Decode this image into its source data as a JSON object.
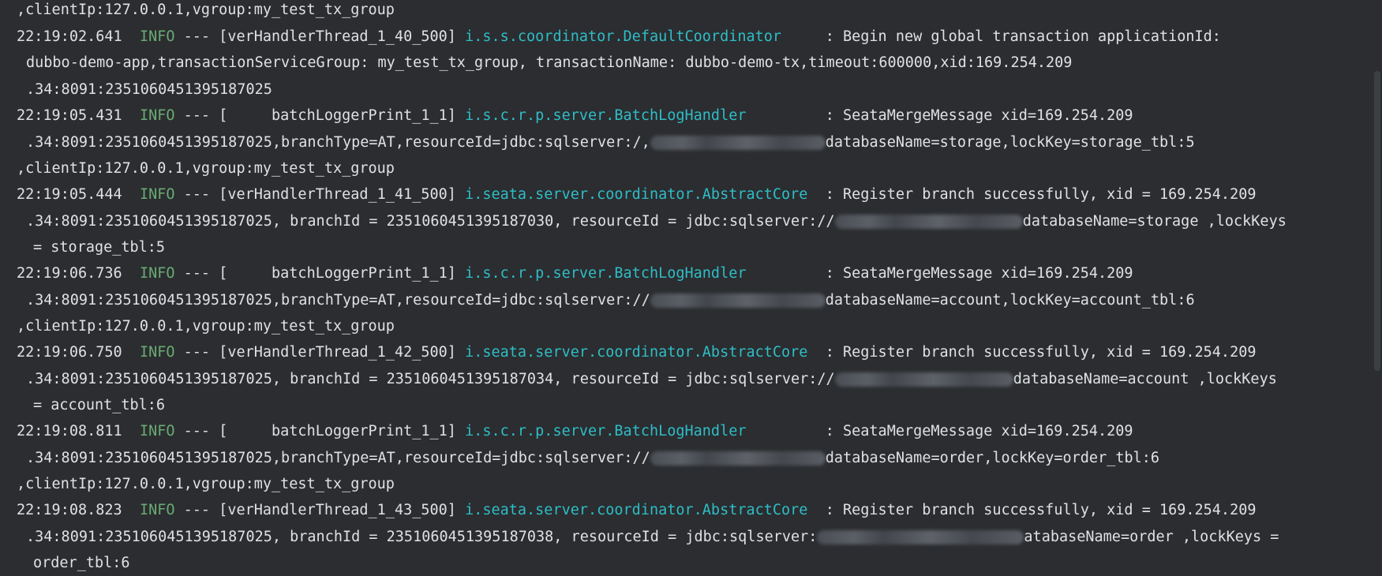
{
  "lines": [
    {
      "text": ",clientIp:127.0.0.1,vgroup:my_test_tx_group"
    },
    {
      "time": "22:19:02.641",
      "level": "INFO",
      "mid": " --- [verHandlerThread_1_40_500] ",
      "cls": "i.s.s.coordinator.DefaultCoordinator",
      "msg": "     : Begin new global transaction applicationId:"
    },
    {
      "text": "dubbo-demo-app,transactionServiceGroup: my_test_tx_group, transactionName: dubbo-demo-tx,timeout:600000,xid:169.254.209"
    },
    {
      "text": ".34:8091:2351060451395187025"
    },
    {
      "time": "22:19:05.431",
      "level": "INFO",
      "mid": " --- [     batchLoggerPrint_1_1] ",
      "cls": "i.s.c.r.p.server.BatchLogHandler",
      "msg": "         : SeataMergeMessage xid=169.254.209"
    },
    {
      "pre": ".34:8091:2351060451395187025,branchType=AT,resourceId=jdbc:sqlserver:/,",
      "post": "databaseName=storage,lockKey=storage_tbl:5"
    },
    {
      "text": ",clientIp:127.0.0.1,vgroup:my_test_tx_group"
    },
    {
      "time": "22:19:05.444",
      "level": "INFO",
      "mid": " --- [verHandlerThread_1_41_500] ",
      "cls": "i.seata.server.coordinator.AbstractCore",
      "msg": "  : Register branch successfully, xid = 169.254.209"
    },
    {
      "pre": ".34:8091:2351060451395187025, branchId = 2351060451395187030, resourceId = jdbc:sqlserver://",
      "post": "databaseName=storage ,lockKeys"
    },
    {
      "text": "= storage_tbl:5"
    },
    {
      "time": "22:19:06.736",
      "level": "INFO",
      "mid": " --- [     batchLoggerPrint_1_1] ",
      "cls": "i.s.c.r.p.server.BatchLogHandler",
      "msg": "         : SeataMergeMessage xid=169.254.209"
    },
    {
      "pre": ".34:8091:2351060451395187025,branchType=AT,resourceId=jdbc:sqlserver://",
      "post": "databaseName=account,lockKey=account_tbl:6"
    },
    {
      "text": ",clientIp:127.0.0.1,vgroup:my_test_tx_group"
    },
    {
      "time": "22:19:06.750",
      "level": "INFO",
      "mid": " --- [verHandlerThread_1_42_500] ",
      "cls": "i.seata.server.coordinator.AbstractCore",
      "msg": "  : Register branch successfully, xid = 169.254.209"
    },
    {
      "pre": ".34:8091:2351060451395187025, branchId = 2351060451395187034, resourceId = jdbc:sqlserver://",
      "post": "databaseName=account ,lockKeys"
    },
    {
      "text": "= account_tbl:6"
    },
    {
      "time": "22:19:08.811",
      "level": "INFO",
      "mid": " --- [     batchLoggerPrint_1_1] ",
      "cls": "i.s.c.r.p.server.BatchLogHandler",
      "msg": "         : SeataMergeMessage xid=169.254.209"
    },
    {
      "pre": ".34:8091:2351060451395187025,branchType=AT,resourceId=jdbc:sqlserver://",
      "post": "databaseName=order,lockKey=order_tbl:6"
    },
    {
      "text": ",clientIp:127.0.0.1,vgroup:my_test_tx_group"
    },
    {
      "time": "22:19:08.823",
      "level": "INFO",
      "mid": " --- [verHandlerThread_1_43_500] ",
      "cls": "i.seata.server.coordinator.AbstractCore",
      "msg": "  : Register branch successfully, xid = 169.254.209"
    },
    {
      "pre": ".34:8091:2351060451395187025, branchId = 2351060451395187038, resourceId = jdbc:sqlserver:",
      "post": "atabaseName=order ,lockKeys ="
    },
    {
      "text": "order_tbl:6"
    }
  ],
  "colors": {
    "background": "#2b2d30",
    "text": "#dfe1e5",
    "info": "#6aab73",
    "logger": "#2fbdc6"
  }
}
